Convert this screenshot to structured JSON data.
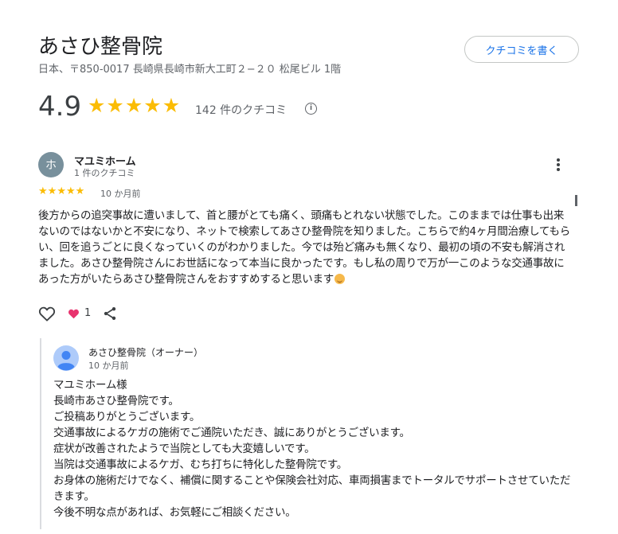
{
  "business": {
    "name": "あさひ整骨院",
    "address": "日本、〒850-0017 長崎県長崎市新大工町２−２０ 松尾ビル 1階",
    "write_review_label": "クチコミを書く",
    "rating": "4.9",
    "stars": 5,
    "review_count_label": "142 件のクチコミ",
    "info_icon": "i"
  },
  "colors": {
    "star": "#fbbc04",
    "accent": "#1a73e8",
    "heart": "#e8336e",
    "avatar_bg": "#78909c"
  },
  "review": {
    "avatar_initial": "ホ",
    "author": "マユミホーム",
    "author_sub": "1 件のクチコミ",
    "stars": 5,
    "date": "10 か月前",
    "text": "後方からの追突事故に遭いまして、首と腰がとても痛く、頭痛もとれない状態でした。このままでは仕事も出来ないのではないかと不安になり、ネットで検索してあさひ整骨院を知りました。こちらで約4ヶ月間治療してもらい、回を追うごとに良くなっていくのがわかりました。今では殆ど痛みも無くなり、最初の頃の不安も解消されました。あさひ整骨院さんにお世話になって本当に良かったです。もし私の周りで万が一このような交通事故にあった方がいたらあさひ整骨院さんをおすすめすると思います",
    "emoji": "smiling-face",
    "reaction_count": "1",
    "icons": [
      "like-heart-outline-icon",
      "heart-reaction-icon",
      "share-icon",
      "more-vert-icon"
    ]
  },
  "owner_reply": {
    "name": "あさひ整骨院（オーナー）",
    "date": "10 か月前",
    "lines": [
      "マユミホーム様",
      "長崎市あさひ整骨院です。",
      "ご投稿ありがとうございます。",
      "交通事故によるケガの施術でご通院いただき、誠にありがとうございます。",
      "症状が改善されたようで当院としても大変嬉しいです。",
      "当院は交通事故によるケガ、むち打ちに特化した整骨院です。",
      "お身体の施術だけでなく、補償に関することや保険会社対応、車両損害までトータルでサポートさせていただきます。",
      "今後不明な点があれば、お気軽にご相談ください。"
    ]
  }
}
